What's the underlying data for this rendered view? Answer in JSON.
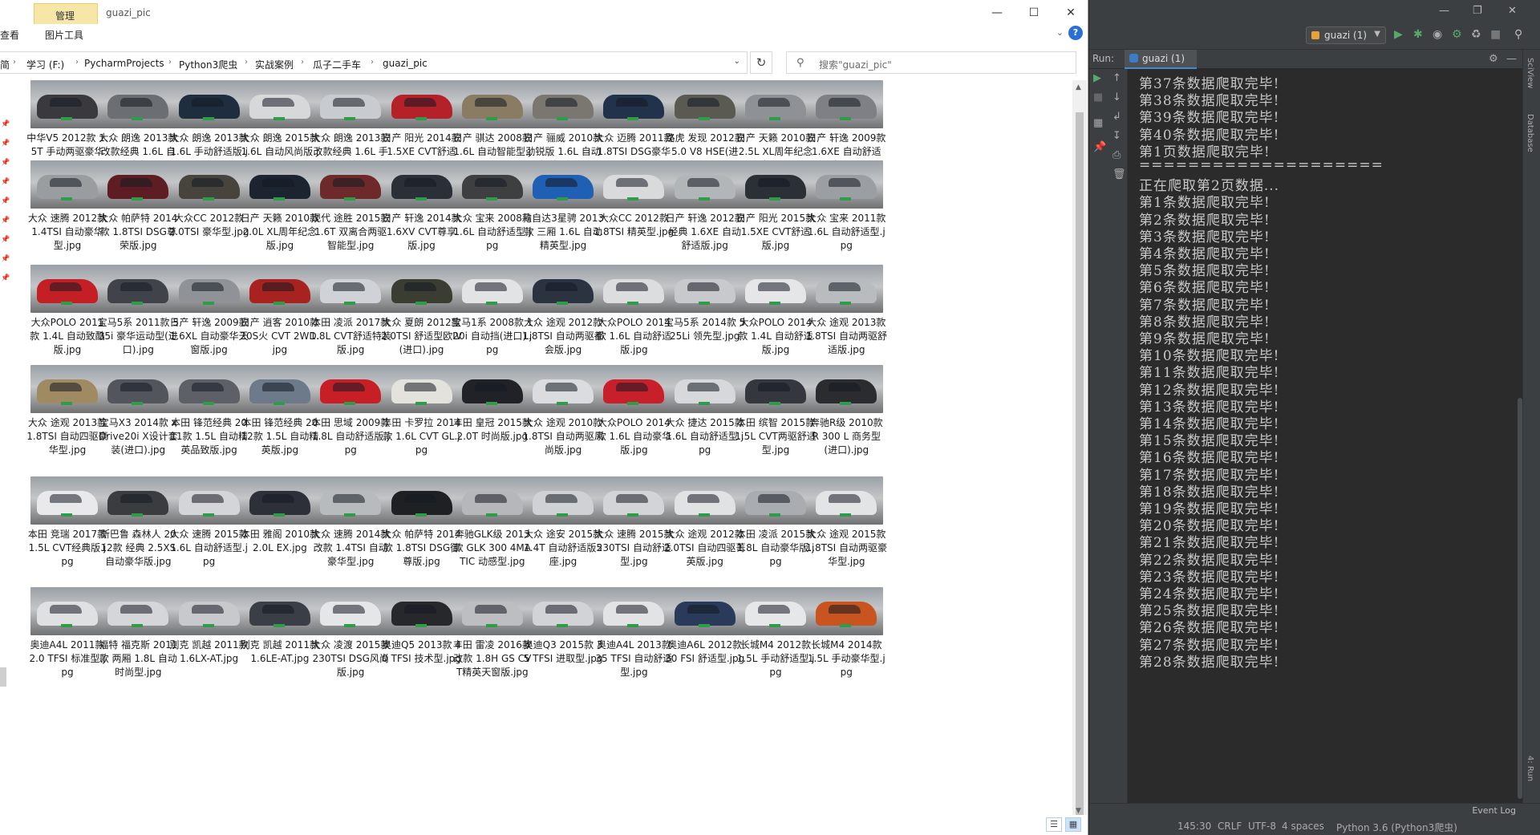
{
  "explorer": {
    "context_tab": "管理",
    "window_title": "guazi_pic",
    "tabs": [
      "查看",
      "图片工具"
    ],
    "breadcrumbs": [
      "简",
      "学习 (F:)",
      "PycharmProjects",
      "Python3爬虫",
      "实战案例",
      "瓜子二手车",
      "guazi_pic"
    ],
    "search_placeholder": "搜索\"guazi_pic\"",
    "files": [
      {
        "name": "中华V5 2012款 1.5T 手动两驱豪华型.jpg",
        "color": "#3a3a3e"
      },
      {
        "name": "大众 朗逸 2013款 改款经典 1.6L 自动风尚版.jpg",
        "color": "#6b6f74"
      },
      {
        "name": "大众 朗逸 2013款 1.6L 手动舒适版.jpg",
        "color": "#1f2e3e"
      },
      {
        "name": "大众 朗逸 2015款 1.6L 自动风尚版.jpg",
        "color": "#d7d8da"
      },
      {
        "name": "大众 朗逸 2013款 改款经典 1.6L 手动舒适版.jpg",
        "color": "#c8ccd0"
      },
      {
        "name": "日产 阳光 2014款 1.5XE CVT舒适版.jpg",
        "color": "#b52128"
      },
      {
        "name": "日产 骐达 2008款 1.6L 自动智能型.jpg",
        "color": "#8a7c62"
      },
      {
        "name": "日产 骊威 2010款 劲锐版 1.6L 自动智能型.jpg",
        "color": "#7a7670"
      },
      {
        "name": "大众 迈腾 2011款 1.8TSI DSG豪华型.jpg",
        "color": "#22324a"
      },
      {
        "name": "路虎 发现 2012款 5.0 V8 HSE(进口).jpg",
        "color": "#5a5a52"
      },
      {
        "name": "日产 天籁 2010款 2.5L XL周年纪念版.jpg",
        "color": "#8e9196"
      },
      {
        "name": "日产 轩逸 2009款 1.6XE 自动舒适版.jpg",
        "color": "#7e8085"
      },
      {
        "name": "大众 速腾 2012款 1.4TSI 自动豪华型.jpg",
        "color": "#9a9da0"
      },
      {
        "name": "大众 帕萨特 2014款 1.8TSI DSG尊荣版.jpg",
        "color": "#5e1d22"
      },
      {
        "name": "大众CC 2012款 2.0TSI 豪华型.jpg",
        "color": "#47443e"
      },
      {
        "name": "日产 天籁 2010款 2.0L XL周年纪念版.jpg",
        "color": "#1c2430"
      },
      {
        "name": "现代 途胜 2015款 1.6T 双离合两驱智能型.jpg",
        "color": "#6e2a2a"
      },
      {
        "name": "日产 轩逸 2014款 1.6XV CVT尊享版.jpg",
        "color": "#2a2f38"
      },
      {
        "name": "大众 宝来 2008款 1.6L 自动舒适型.jpg",
        "color": "#3e3f40"
      },
      {
        "name": "马自达3星骋 2013款 三厢 1.6L 自动精英型.jpg",
        "color": "#1f5fb4"
      },
      {
        "name": "大众CC 2012款 1.8TSI 精英型.jpg",
        "color": "#d9dadc"
      },
      {
        "name": "日产 轩逸 2012款 经典 1.6XE 自动舒适版.jpg",
        "color": "#b3b6b9"
      },
      {
        "name": "日产 阳光 2015款 1.5XE CVT舒适版.jpg",
        "color": "#2b2f36"
      },
      {
        "name": "大众 宝来 2011款 1.6L 自动舒适型.jpg",
        "color": "#9b9ea2"
      },
      {
        "name": "大众POLO 2011款 1.4L 自动致酷版.jpg",
        "color": "#c41f24"
      },
      {
        "name": "宝马5系 2011款 535i 豪华运动型(进口).jpg",
        "color": "#40444a"
      },
      {
        "name": "日产 轩逸 2009款 1.6XL 自动豪华天窗版.jpg",
        "color": "#8f9296"
      },
      {
        "name": "日产 逍客 2010款 20S火 CVT 2WD.jpg",
        "color": "#a8221f"
      },
      {
        "name": "本田 凌派 2017款 1.8L CVT舒适特装版.jpg",
        "color": "#cfd2d6"
      },
      {
        "name": "大众 夏朗 2012款 2.0TSI 舒适型欧IV(进口).jpg",
        "color": "#3b3d33"
      },
      {
        "name": "宝马1系 2008款 120i 自动挡(进口).jpg",
        "color": "#e2e3e5"
      },
      {
        "name": "大众 途观 2012款 1.8TSI 自动两驱都会版.jpg",
        "color": "#2c3340"
      },
      {
        "name": "大众POLO 2014款 1.6L 自动舒适版.jpg",
        "color": "#dcdddf"
      },
      {
        "name": "宝马5系 2014款 525Li 领先型.jpg",
        "color": "#c7c9cc"
      },
      {
        "name": "大众POLO 2014款 1.4L 自动舒适版.jpg",
        "color": "#e6e6e8"
      },
      {
        "name": "大众 途观 2013款 1.8TSI 自动两驱舒适版.jpg",
        "color": "#b9bcbf"
      },
      {
        "name": "大众 途观 2013款 1.8TSI 自动四驱豪华型.jpg",
        "color": "#a08a62"
      },
      {
        "name": "宝马X3 2014款 xDrive20i X设计套装(进口).jpg",
        "color": "#52565c"
      },
      {
        "name": "本田 锋范经典 2011款 1.5L 自动精英品致版.jpg",
        "color": "#5d6066"
      },
      {
        "name": "本田 锋范经典 2012款 1.5L 自动精英版.jpg",
        "color": "#6c7a8a"
      },
      {
        "name": "本田 思域 2009款 1.8L 自动舒适版.jpg",
        "color": "#c81f26"
      },
      {
        "name": "丰田 卡罗拉 2014款 1.6L CVT GL.jpg",
        "color": "#e4e2dc"
      },
      {
        "name": "丰田 皇冠 2015款 2.0T 时尚版.jpg",
        "color": "#202228"
      },
      {
        "name": "大众 途观 2010款 1.8TSI 自动两驱风尚版.jpg",
        "color": "#dadcdf"
      },
      {
        "name": "大众POLO 2014款 1.6L 自动豪华版.jpg",
        "color": "#c8202a"
      },
      {
        "name": "大众 捷达 2015款 1.6L 自动舒适型.jpg",
        "color": "#d6d8db"
      },
      {
        "name": "本田 缤智 2015款 1.5L CVT两驱舒适型.jpg",
        "color": "#34383e"
      },
      {
        "name": "奔驰R级 2010款 R 300 L 商务型(进口).jpg",
        "color": "#2a2c30"
      },
      {
        "name": "本田 竞瑞 2017款 1.5L CVT经典版.jpg",
        "color": "#e9e9eb"
      },
      {
        "name": "斯巴鲁 森林人 2012款 经典 2.5XS 自动豪华版.jpg",
        "color": "#3a3c40"
      },
      {
        "name": "大众 速腾 2015款 1.6L 自动舒适型.jpg",
        "color": "#d3d5d8"
      },
      {
        "name": "本田 雅阁 2010款 2.0L EX.jpg",
        "color": "#2d3038"
      },
      {
        "name": "大众 速腾 2014款 改款 1.4TSI 自动豪华型.jpg",
        "color": "#b8bbbe"
      },
      {
        "name": "大众 帕萨特 2014款 1.8TSI DSG御尊版.jpg",
        "color": "#1e2024"
      },
      {
        "name": "奔驰GLK级 2013款 GLK 300 4MATIC 动感型.jpg",
        "color": "#b5b7ba"
      },
      {
        "name": "大众 途安 2015款 1.4T 自动舒适版5座.jpg",
        "color": "#cfd1d4"
      },
      {
        "name": "大众 速腾 2015款 230TSI 自动舒适型.jpg",
        "color": "#d2d4d7"
      },
      {
        "name": "大众 途观 2012款 2.0TSI 自动四驱菁英版.jpg",
        "color": "#e1e2e4"
      },
      {
        "name": "本田 凌派 2015款 1.8L 自动豪华版.jpg",
        "color": "#a9acb0"
      },
      {
        "name": "大众 途观 2015款 1.8TSI 自动两驱豪华型.jpg",
        "color": "#e3e4e6"
      },
      {
        "name": "奥迪A4L 2011款 2.0 TFSI 标准型.jpg",
        "color": "#dfe0e2"
      },
      {
        "name": "福特 福克斯 2011款 两厢 1.8L 自动时尚型.jpg",
        "color": "#d4d6d9"
      },
      {
        "name": "别克 凯越 2011款 1.6LX-AT.jpg",
        "color": "#c7c9cc"
      },
      {
        "name": "别克 凯越 2011款 1.6LE-AT.jpg",
        "color": "#3a3e46"
      },
      {
        "name": "大众 凌渡 2015款 230TSI DSG风尚版.jpg",
        "color": "#e5e6e8"
      },
      {
        "name": "奥迪Q5 2013款 40 TFSI 技术型.jpg",
        "color": "#26282c"
      },
      {
        "name": "丰田 雷凌 2016款 改款 1.8H GS CVT精英天窗版.jpg",
        "color": "#bcbec1"
      },
      {
        "name": "奥迪Q3 2015款 35 TFSI 进取型.jpg",
        "color": "#d1d3d6"
      },
      {
        "name": "奥迪A4L 2013款 35 TFSI 自动舒适型.jpg",
        "color": "#e2e3e5"
      },
      {
        "name": "奥迪A6L 2012款 30 FSI 舒适型.jpg",
        "color": "#2a3a5a"
      },
      {
        "name": "长城M4 2012款 1.5L 手动舒适型.jpg",
        "color": "#e6e7e9"
      },
      {
        "name": "长城M4 2014款 1.5L 手动豪华型.jpg",
        "color": "#c8541f"
      }
    ]
  },
  "pycharm": {
    "config_name": "guazi (1)",
    "run_label": "Run:",
    "run_tab": "guazi (1)",
    "side_labels": [
      "SciView",
      "Database"
    ],
    "bottom_side_label": "4: Run",
    "event_log": "Event Log",
    "console_lines": [
      "第37条数据爬取完毕!",
      "第38条数据爬取完毕!",
      "第39条数据爬取完毕!",
      "第40条数据爬取完毕!",
      "第1页数据爬取完毕!",
      "====================",
      "正在爬取第2页数据...",
      "第1条数据爬取完毕!",
      "第2条数据爬取完毕!",
      "第3条数据爬取完毕!",
      "第4条数据爬取完毕!",
      "第5条数据爬取完毕!",
      "第6条数据爬取完毕!",
      "第7条数据爬取完毕!",
      "第8条数据爬取完毕!",
      "第9条数据爬取完毕!",
      "第10条数据爬取完毕!",
      "第11条数据爬取完毕!",
      "第12条数据爬取完毕!",
      "第13条数据爬取完毕!",
      "第14条数据爬取完毕!",
      "第15条数据爬取完毕!",
      "第16条数据爬取完毕!",
      "第17条数据爬取完毕!",
      "第18条数据爬取完毕!",
      "第19条数据爬取完毕!",
      "第20条数据爬取完毕!",
      "第21条数据爬取完毕!",
      "第22条数据爬取完毕!",
      "第23条数据爬取完毕!",
      "第24条数据爬取完毕!",
      "第25条数据爬取完毕!",
      "第26条数据爬取完毕!",
      "第27条数据爬取完毕!",
      "第28条数据爬取完毕!"
    ],
    "status": {
      "position": "145:30",
      "line_sep": "CRLF",
      "encoding": "UTF-8",
      "indent": "4 spaces",
      "interpreter": "Python 3.6 (Python3爬虫)"
    }
  }
}
